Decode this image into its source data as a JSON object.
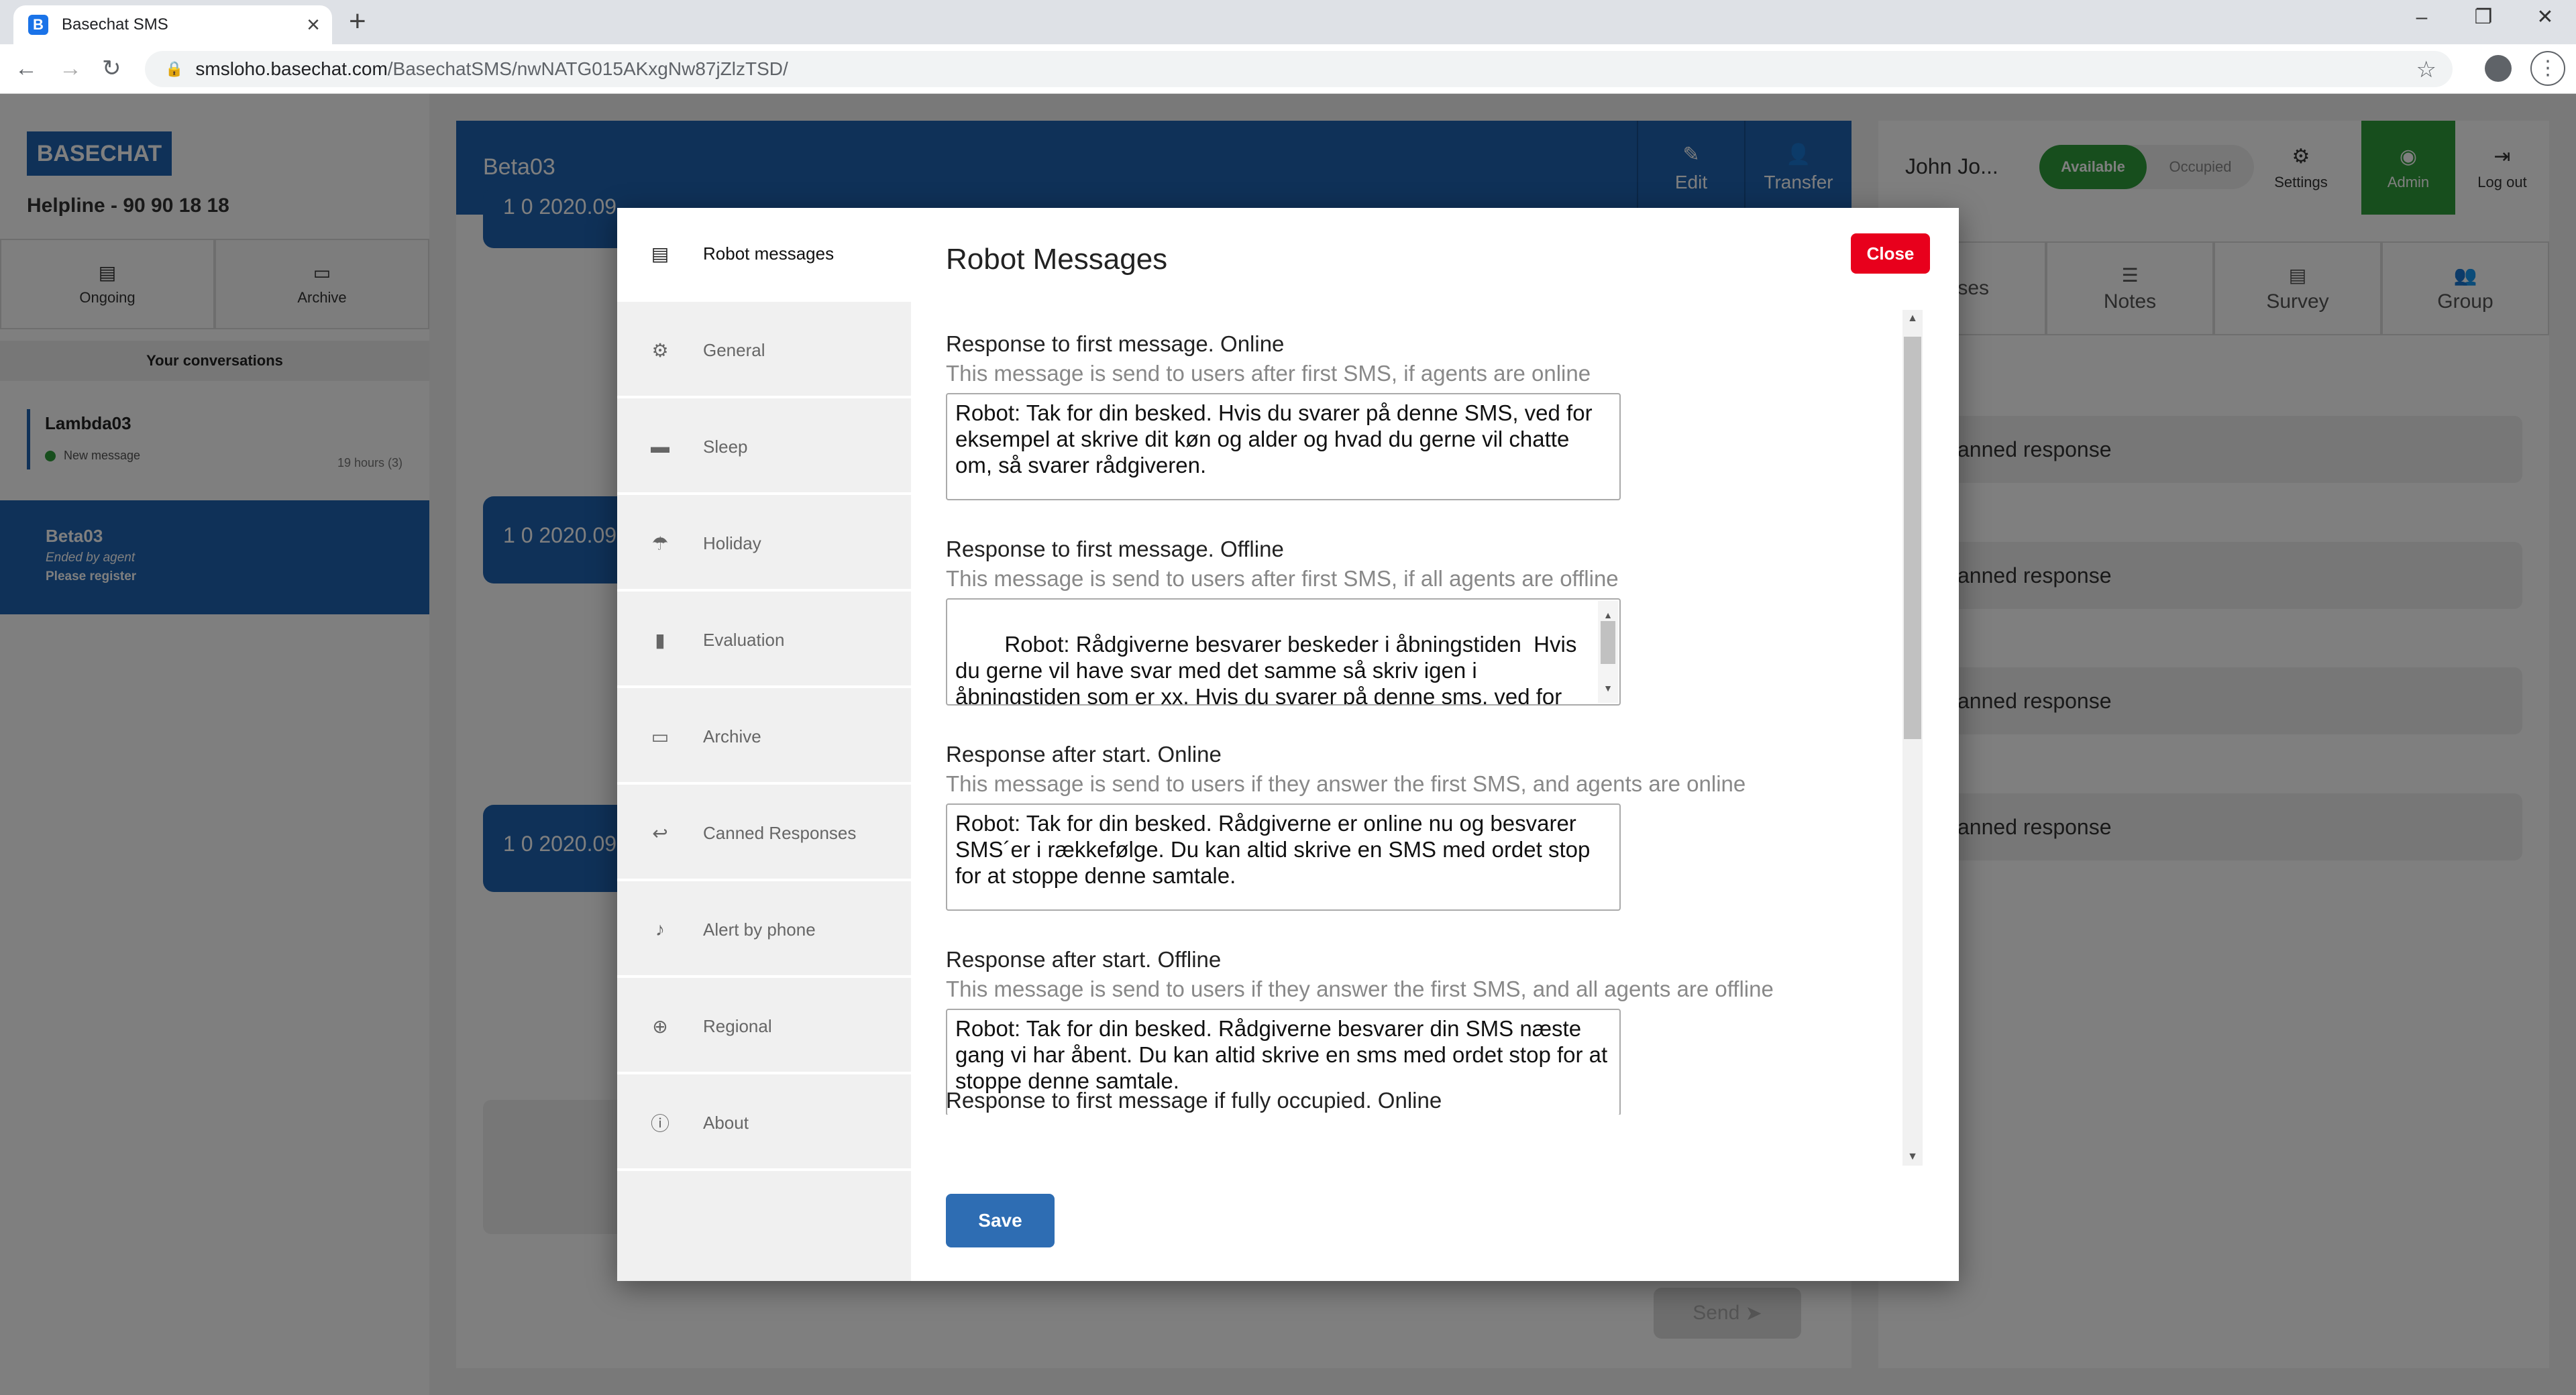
{
  "browser": {
    "tab_title": "Basechat SMS",
    "favicon_letter": "B",
    "url_host": "smsloho.basechat.com",
    "url_path": "/BasechatSMS/nwNATG015AKxgNw87jZlzTSD/"
  },
  "app": {
    "logo": "BASECHAT",
    "helpline": "Helpline - 90 90 18 18",
    "left_tabs": [
      {
        "label": "Ongoing",
        "icon": "chat-icon"
      },
      {
        "label": "Archive",
        "icon": "folder-icon"
      }
    ],
    "your_conversations": "Your conversations",
    "conversations": [
      {
        "name": "Lambda03",
        "status": "New message",
        "time": "19 hours (3)"
      },
      {
        "name": "Beta03",
        "status": "Ended by agent",
        "note": "Please register"
      }
    ],
    "chat": {
      "title": "Beta03",
      "edit_label": "Edit",
      "transfer_label": "Transfer",
      "bubble_texts": [
        "1 0 2020.09",
        "1 0 2020.09",
        "1 0 2020.09"
      ],
      "send_label": "Send"
    },
    "right_panel": {
      "agent_name": "John Jo...",
      "available_label": "Available",
      "occupied_label": "Occupied",
      "settings_label": "Settings",
      "admin_label": "Admin",
      "logout_label": "Log out",
      "tabs": [
        "onses",
        "Notes",
        "Survey",
        "Group"
      ],
      "canned_items": [
        "w canned response",
        "w canned response",
        "w canned response",
        "w canned response"
      ]
    }
  },
  "modal": {
    "title": "Robot Messages",
    "close_label": "Close",
    "save_label": "Save",
    "nav": [
      {
        "label": "Robot messages",
        "icon": "message-icon",
        "active": true
      },
      {
        "label": "General",
        "icon": "gear-icon"
      },
      {
        "label": "Sleep",
        "icon": "bed-icon"
      },
      {
        "label": "Holiday",
        "icon": "beach-icon"
      },
      {
        "label": "Evaluation",
        "icon": "bar-chart-icon"
      },
      {
        "label": "Archive",
        "icon": "folder-icon"
      },
      {
        "label": "Canned Responses",
        "icon": "reply-icon"
      },
      {
        "label": "Alert by phone",
        "icon": "bell-icon"
      },
      {
        "label": "Regional",
        "icon": "globe-icon"
      },
      {
        "label": "About",
        "icon": "info-icon"
      }
    ],
    "fields": [
      {
        "title": "Response to first message. Online",
        "description": "This message is send to users after first SMS, if agents are online",
        "value": "Robot: Tak for din besked. Hvis du svarer på denne SMS, ved for eksempel at skrive dit køn og alder og hvad du gerne vil chatte om, så svarer rådgiveren."
      },
      {
        "title": "Response to first message. Offline",
        "description": "This message is send to users after first SMS, if all agents are offline",
        "value": "Robot: Rådgiverne besvarer beskeder i åbningstiden  Hvis du gerne vil have svar med det samme så skriv igen i åbningstiden som er xx. Hvis du svarer på denne sms, ved for eksempel at skrive dit køn og alder og hvad du gerne vil"
      },
      {
        "title": "Response after start. Online",
        "description": "This message is send to users if they answer the first SMS, and agents are online",
        "value": "Robot: Tak for din besked. Rådgiverne er online nu og besvarer SMS´er i rækkefølge. Du kan altid skrive en SMS med ordet stop for at stoppe denne samtale."
      },
      {
        "title": "Response after start. Offline",
        "description": "This message is send to users if they answer the first SMS, and all agents are offline",
        "value": "Robot: Tak for din besked. Rådgiverne besvarer din SMS næste gang vi har åbent. Du kan altid skrive en sms med ordet stop for at stoppe denne samtale."
      }
    ],
    "cut_off_title": "Response to first message if fully occupied. Online"
  }
}
